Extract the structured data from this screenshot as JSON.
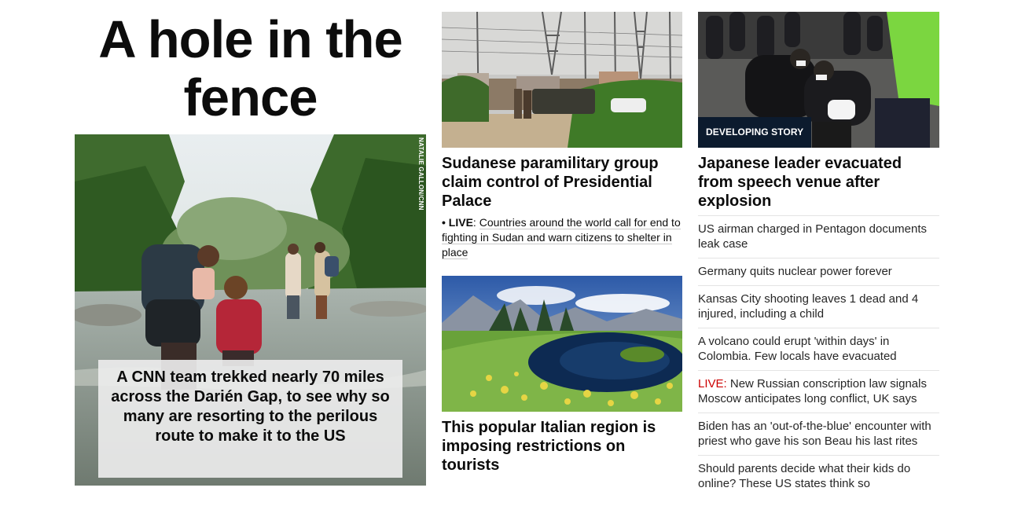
{
  "lead": {
    "headline": "A hole in the fence",
    "image_credit": "NATALIE GALLON/CNN",
    "caption": "A CNN team trekked nearly 70 miles across the Darién Gap, to see why so many are resorting to the perilous route to make it to the US"
  },
  "middle": {
    "story1": {
      "headline": "Sudanese paramilitary group claim control of Presidential Palace",
      "bullet": "• LIVE",
      "live_text": "Countries around the world call for end to fighting in Sudan and warn citizens to shelter in place"
    },
    "story2": {
      "headline": "This popular Italian region is imposing restrictions on tourists"
    }
  },
  "right": {
    "badge": "DEVELOPING STORY",
    "headline": "Japanese leader evacuated from speech venue after explosion",
    "list": [
      {
        "live": "",
        "text": "US airman charged in Pentagon documents leak case"
      },
      {
        "live": "",
        "text": "Germany quits nuclear power forever"
      },
      {
        "live": "",
        "text": "Kansas City shooting leaves 1 dead and 4 injured, including a child"
      },
      {
        "live": "",
        "text": "A volcano could erupt 'within days' in Colombia. Few locals have evacuated"
      },
      {
        "live": "LIVE:",
        "text": " New Russian conscription law signals Moscow anticipates long conflict, UK says"
      },
      {
        "live": "",
        "text": "Biden has an 'out-of-the-blue' encounter with priest who gave his son Beau his last rites"
      },
      {
        "live": "",
        "text": "Should parents decide what their kids do online? These US states think so"
      }
    ]
  },
  "colors": {
    "live_red": "#cc0000",
    "badge_bg": "#0c1b2e",
    "text": "#0c0c0c"
  }
}
